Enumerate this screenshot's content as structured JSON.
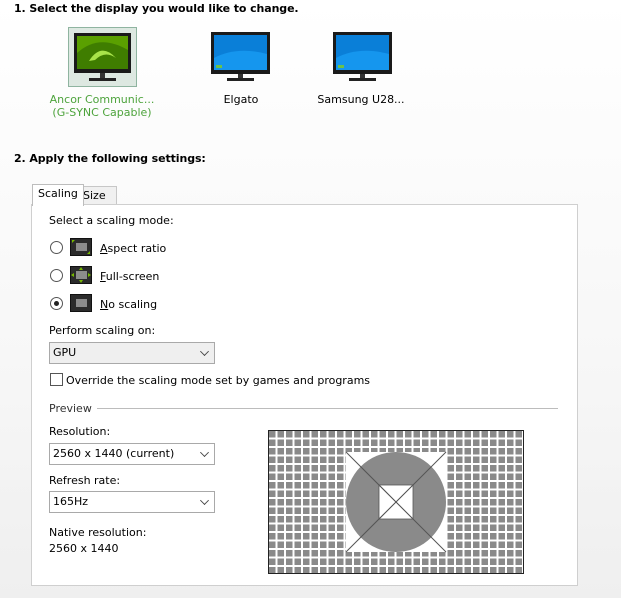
{
  "step1": {
    "title": "1. Select the display you would like to change."
  },
  "displays": [
    {
      "line1": "Ancor Communic...",
      "line2": "(G-SYNC Capable)"
    },
    {
      "line1": "Elgato",
      "line2": ""
    },
    {
      "line1": "Samsung U28...",
      "line2": ""
    }
  ],
  "step2": {
    "title": "2. Apply the following settings:"
  },
  "tabs": {
    "scaling": "Scaling",
    "size": "Size"
  },
  "scaling": {
    "mode_label": "Select a scaling mode:",
    "options": [
      {
        "mnemonic": "A",
        "rest": "spect ratio"
      },
      {
        "mnemonic": "F",
        "rest": "ull-screen"
      },
      {
        "mnemonic": "N",
        "rest": "o scaling"
      }
    ],
    "selected_option": "No scaling",
    "perform_label": "Perform scaling on:",
    "perform_value": "GPU",
    "override_label": "Override the scaling mode set by games and programs",
    "override_checked": false
  },
  "preview": {
    "title": "Preview",
    "resolution_label": "Resolution:",
    "resolution_value": "2560 x 1440 (current)",
    "refresh_label": "Refresh rate:",
    "refresh_value": "165Hz",
    "native_label": "Native resolution:",
    "native_value": "2560 x 1440"
  },
  "colors": {
    "accent_green": "#4da33c",
    "nvidia_green": "#76b900",
    "screen_blue": "#0a7fd8"
  }
}
